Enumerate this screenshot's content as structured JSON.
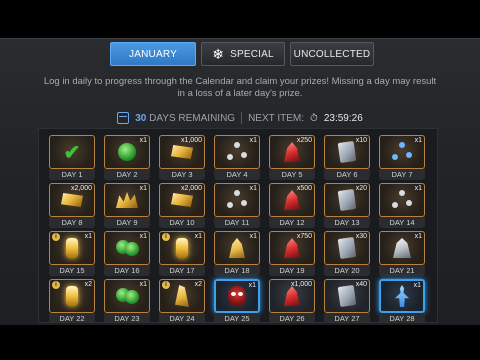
{
  "tabs": [
    {
      "label": "JANUARY",
      "active": true
    },
    {
      "label": "SPECIAL",
      "active": false,
      "icon": "snowflake-icon"
    },
    {
      "label": "UNCOLLECTED",
      "active": false
    }
  ],
  "description": "Log in daily to progress through the Calendar and claim your prizes! Missing a day may result in a loss of a later day's prize.",
  "status": {
    "days_remaining_num": "30",
    "days_remaining_text": "DAYS REMAINING",
    "next_item_label": "NEXT ITEM:",
    "next_item_time": "23:59:26"
  },
  "colors": {
    "tab_active": "#3a8ad8",
    "accent_blue": "#6aa7e8",
    "tile_border_gold": "#b9823e",
    "today_border": "#3aa0f0",
    "check_green": "#39c43b"
  },
  "days": [
    {
      "label": "DAY 1",
      "qty": "",
      "item": "claimed-check",
      "state": "claimed",
      "info": false
    },
    {
      "label": "DAY 2",
      "qty": "x1",
      "item": "green-orb",
      "state": "claimed",
      "info": false
    },
    {
      "label": "DAY 3",
      "qty": "x1,000",
      "item": "gold",
      "state": "claimed",
      "info": false
    },
    {
      "label": "DAY 4",
      "qty": "x1",
      "item": "catalyst-node",
      "state": "claimed",
      "info": false
    },
    {
      "label": "DAY 5",
      "qty": "x250",
      "item": "red-crystal",
      "state": "claimed",
      "info": false
    },
    {
      "label": "DAY 6",
      "qty": "x10",
      "item": "scroll",
      "state": "claimed",
      "info": false
    },
    {
      "label": "DAY 7",
      "qty": "x1",
      "item": "blue-node",
      "state": "claimed",
      "info": false
    },
    {
      "label": "DAY 8",
      "qty": "x2,000",
      "item": "gold",
      "state": "claimed",
      "info": false
    },
    {
      "label": "DAY 9",
      "qty": "x1",
      "item": "gold-pile",
      "state": "claimed",
      "info": false
    },
    {
      "label": "DAY 10",
      "qty": "x2,000",
      "item": "gold",
      "state": "claimed",
      "info": false
    },
    {
      "label": "DAY 11",
      "qty": "x1",
      "item": "catalyst-node",
      "state": "claimed",
      "info": false
    },
    {
      "label": "DAY 12",
      "qty": "x500",
      "item": "red-crystal",
      "state": "claimed",
      "info": false
    },
    {
      "label": "DAY 13",
      "qty": "x20",
      "item": "scroll",
      "state": "claimed",
      "info": false
    },
    {
      "label": "DAY 14",
      "qty": "x1",
      "item": "catalyst-node",
      "state": "claimed",
      "info": false
    },
    {
      "label": "DAY 15",
      "qty": "x1",
      "item": "gold-glow",
      "state": "claimed",
      "info": true
    },
    {
      "label": "DAY 16",
      "qty": "x1",
      "item": "green-orb-pair",
      "state": "claimed",
      "info": false
    },
    {
      "label": "DAY 17",
      "qty": "x1",
      "item": "gold-glow",
      "state": "claimed",
      "info": true
    },
    {
      "label": "DAY 18",
      "qty": "x1",
      "item": "gold-crystal",
      "state": "claimed",
      "info": false
    },
    {
      "label": "DAY 19",
      "qty": "x750",
      "item": "red-crystal",
      "state": "claimed",
      "info": false
    },
    {
      "label": "DAY 20",
      "qty": "x30",
      "item": "scroll",
      "state": "claimed",
      "info": false
    },
    {
      "label": "DAY 21",
      "qty": "x1",
      "item": "white-crystal",
      "state": "claimed",
      "info": false
    },
    {
      "label": "DAY 22",
      "qty": "x2",
      "item": "gold-glow",
      "state": "claimed",
      "info": true
    },
    {
      "label": "DAY 23",
      "qty": "x1",
      "item": "green-orb-pair",
      "state": "claimed",
      "info": false
    },
    {
      "label": "DAY 24",
      "qty": "x2",
      "item": "gold-shard",
      "state": "claimed",
      "info": true
    },
    {
      "label": "DAY 25",
      "qty": "x1",
      "item": "spider-champion",
      "state": "today",
      "info": false
    },
    {
      "label": "DAY 26",
      "qty": "x1,000",
      "item": "red-crystal",
      "state": "locked",
      "info": false
    },
    {
      "label": "DAY 27",
      "qty": "x40",
      "item": "scroll",
      "state": "locked",
      "info": false
    },
    {
      "label": "DAY 28",
      "qty": "x1",
      "item": "blue-figure",
      "state": "today",
      "info": false
    }
  ]
}
